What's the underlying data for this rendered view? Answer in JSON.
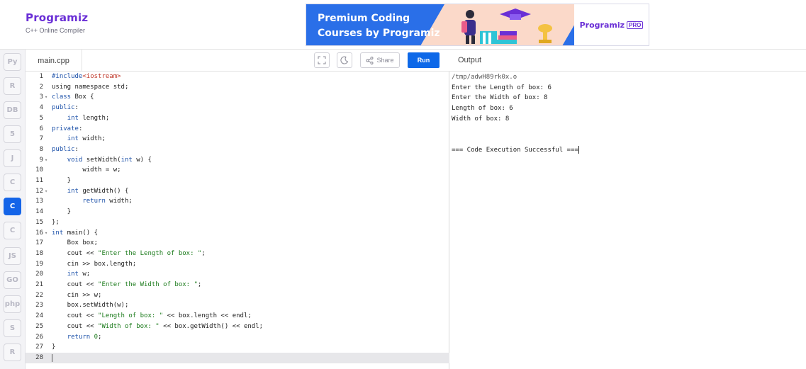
{
  "header": {
    "logo_name": "Programiz",
    "logo_sub": "C++ Online Compiler",
    "ad": {
      "title_line1": "Premium Coding",
      "title_line2": "Courses by Programiz",
      "brand": "Programiz",
      "badge": "PRO"
    }
  },
  "sidebar": {
    "items": [
      {
        "name": "python-icon",
        "glyph": "Py"
      },
      {
        "name": "r-icon",
        "glyph": "R"
      },
      {
        "name": "sql-icon",
        "glyph": "DB"
      },
      {
        "name": "html-icon",
        "glyph": "5"
      },
      {
        "name": "java-icon",
        "glyph": "J"
      },
      {
        "name": "c-icon",
        "glyph": "C"
      },
      {
        "name": "cpp-icon",
        "glyph": "C"
      },
      {
        "name": "csharp-icon",
        "glyph": "C"
      },
      {
        "name": "js-icon",
        "glyph": "JS"
      },
      {
        "name": "go-icon",
        "glyph": "GO"
      },
      {
        "name": "php-icon",
        "glyph": "php"
      },
      {
        "name": "swift-icon",
        "glyph": "S"
      },
      {
        "name": "rust-icon",
        "glyph": "R"
      }
    ]
  },
  "editor": {
    "file_tab": "main.cpp",
    "share_label": "Share",
    "run_label": "Run",
    "lines": [
      {
        "n": "1",
        "fold": "",
        "code": [
          {
            "t": "#include",
            "c": "kw"
          },
          {
            "t": "<iostream>",
            "c": "inc"
          }
        ]
      },
      {
        "n": "2",
        "fold": "",
        "code": [
          {
            "t": "using namespace std;",
            "c": ""
          }
        ]
      },
      {
        "n": "3",
        "fold": "▾",
        "code": [
          {
            "t": "class",
            "c": "kw"
          },
          {
            "t": " Box {",
            "c": ""
          }
        ]
      },
      {
        "n": "4",
        "fold": "",
        "code": [
          {
            "t": "public",
            "c": "kw"
          },
          {
            "t": ":",
            "c": ""
          }
        ]
      },
      {
        "n": "5",
        "fold": "",
        "code": [
          {
            "t": "    ",
            "c": ""
          },
          {
            "t": "int",
            "c": "kw"
          },
          {
            "t": " length;",
            "c": ""
          }
        ]
      },
      {
        "n": "6",
        "fold": "",
        "code": [
          {
            "t": "private",
            "c": "kw"
          },
          {
            "t": ":",
            "c": ""
          }
        ]
      },
      {
        "n": "7",
        "fold": "",
        "code": [
          {
            "t": "    ",
            "c": ""
          },
          {
            "t": "int",
            "c": "kw"
          },
          {
            "t": " width;",
            "c": ""
          }
        ]
      },
      {
        "n": "8",
        "fold": "",
        "code": [
          {
            "t": "public",
            "c": "kw"
          },
          {
            "t": ":",
            "c": ""
          }
        ]
      },
      {
        "n": "9",
        "fold": "▾",
        "code": [
          {
            "t": "    ",
            "c": ""
          },
          {
            "t": "void",
            "c": "kw"
          },
          {
            "t": " setWidth(",
            "c": ""
          },
          {
            "t": "int",
            "c": "kw"
          },
          {
            "t": " w) {",
            "c": ""
          }
        ]
      },
      {
        "n": "10",
        "fold": "",
        "code": [
          {
            "t": "        width = w;",
            "c": ""
          }
        ]
      },
      {
        "n": "11",
        "fold": "",
        "code": [
          {
            "t": "    }",
            "c": ""
          }
        ]
      },
      {
        "n": "12",
        "fold": "▾",
        "code": [
          {
            "t": "    ",
            "c": ""
          },
          {
            "t": "int",
            "c": "kw"
          },
          {
            "t": " getWidth() {",
            "c": ""
          }
        ]
      },
      {
        "n": "13",
        "fold": "",
        "code": [
          {
            "t": "        ",
            "c": ""
          },
          {
            "t": "return",
            "c": "kw"
          },
          {
            "t": " width;",
            "c": ""
          }
        ]
      },
      {
        "n": "14",
        "fold": "",
        "code": [
          {
            "t": "    }",
            "c": ""
          }
        ]
      },
      {
        "n": "15",
        "fold": "",
        "code": [
          {
            "t": "};",
            "c": ""
          }
        ]
      },
      {
        "n": "16",
        "fold": "▾",
        "code": [
          {
            "t": "int",
            "c": "kw"
          },
          {
            "t": " main() {",
            "c": ""
          }
        ]
      },
      {
        "n": "17",
        "fold": "",
        "code": [
          {
            "t": "    Box box;",
            "c": ""
          }
        ]
      },
      {
        "n": "18",
        "fold": "",
        "code": [
          {
            "t": "    cout << ",
            "c": ""
          },
          {
            "t": "\"Enter the Length of box: \"",
            "c": "str"
          },
          {
            "t": ";",
            "c": ""
          }
        ]
      },
      {
        "n": "19",
        "fold": "",
        "code": [
          {
            "t": "    cin >> box.length;",
            "c": ""
          }
        ]
      },
      {
        "n": "20",
        "fold": "",
        "code": [
          {
            "t": "    ",
            "c": ""
          },
          {
            "t": "int",
            "c": "kw"
          },
          {
            "t": " w;",
            "c": ""
          }
        ]
      },
      {
        "n": "21",
        "fold": "",
        "code": [
          {
            "t": "    cout << ",
            "c": ""
          },
          {
            "t": "\"Enter the Width of box: \"",
            "c": "str"
          },
          {
            "t": ";",
            "c": ""
          }
        ]
      },
      {
        "n": "22",
        "fold": "",
        "code": [
          {
            "t": "    cin >> w;",
            "c": ""
          }
        ]
      },
      {
        "n": "23",
        "fold": "",
        "code": [
          {
            "t": "    box.setWidth(w);",
            "c": ""
          }
        ]
      },
      {
        "n": "24",
        "fold": "",
        "code": [
          {
            "t": "    cout << ",
            "c": ""
          },
          {
            "t": "\"Length of box: \"",
            "c": "str"
          },
          {
            "t": " << box.length << endl;",
            "c": ""
          }
        ]
      },
      {
        "n": "25",
        "fold": "",
        "code": [
          {
            "t": "    cout << ",
            "c": ""
          },
          {
            "t": "\"Width of box: \"",
            "c": "str"
          },
          {
            "t": " << box.getWidth() << endl;",
            "c": ""
          }
        ]
      },
      {
        "n": "26",
        "fold": "",
        "code": [
          {
            "t": "    ",
            "c": ""
          },
          {
            "t": "return",
            "c": "kw"
          },
          {
            "t": " ",
            "c": ""
          },
          {
            "t": "0",
            "c": "num"
          },
          {
            "t": ";",
            "c": ""
          }
        ]
      },
      {
        "n": "27",
        "fold": "",
        "code": [
          {
            "t": "}",
            "c": ""
          }
        ]
      },
      {
        "n": "28",
        "fold": "",
        "code": []
      }
    ]
  },
  "output": {
    "title": "Output",
    "lines": [
      "/tmp/adwH89rk0x.o",
      "Enter the Length of box: 6",
      "Enter the Width of box: 8",
      "Length of box: 6",
      "Width of box: 8",
      "",
      "",
      "=== Code Execution Successful ==="
    ]
  },
  "colors": {
    "brand": "#6a2fd6",
    "run": "#0d68e8",
    "active_lang": "#1464e8"
  }
}
